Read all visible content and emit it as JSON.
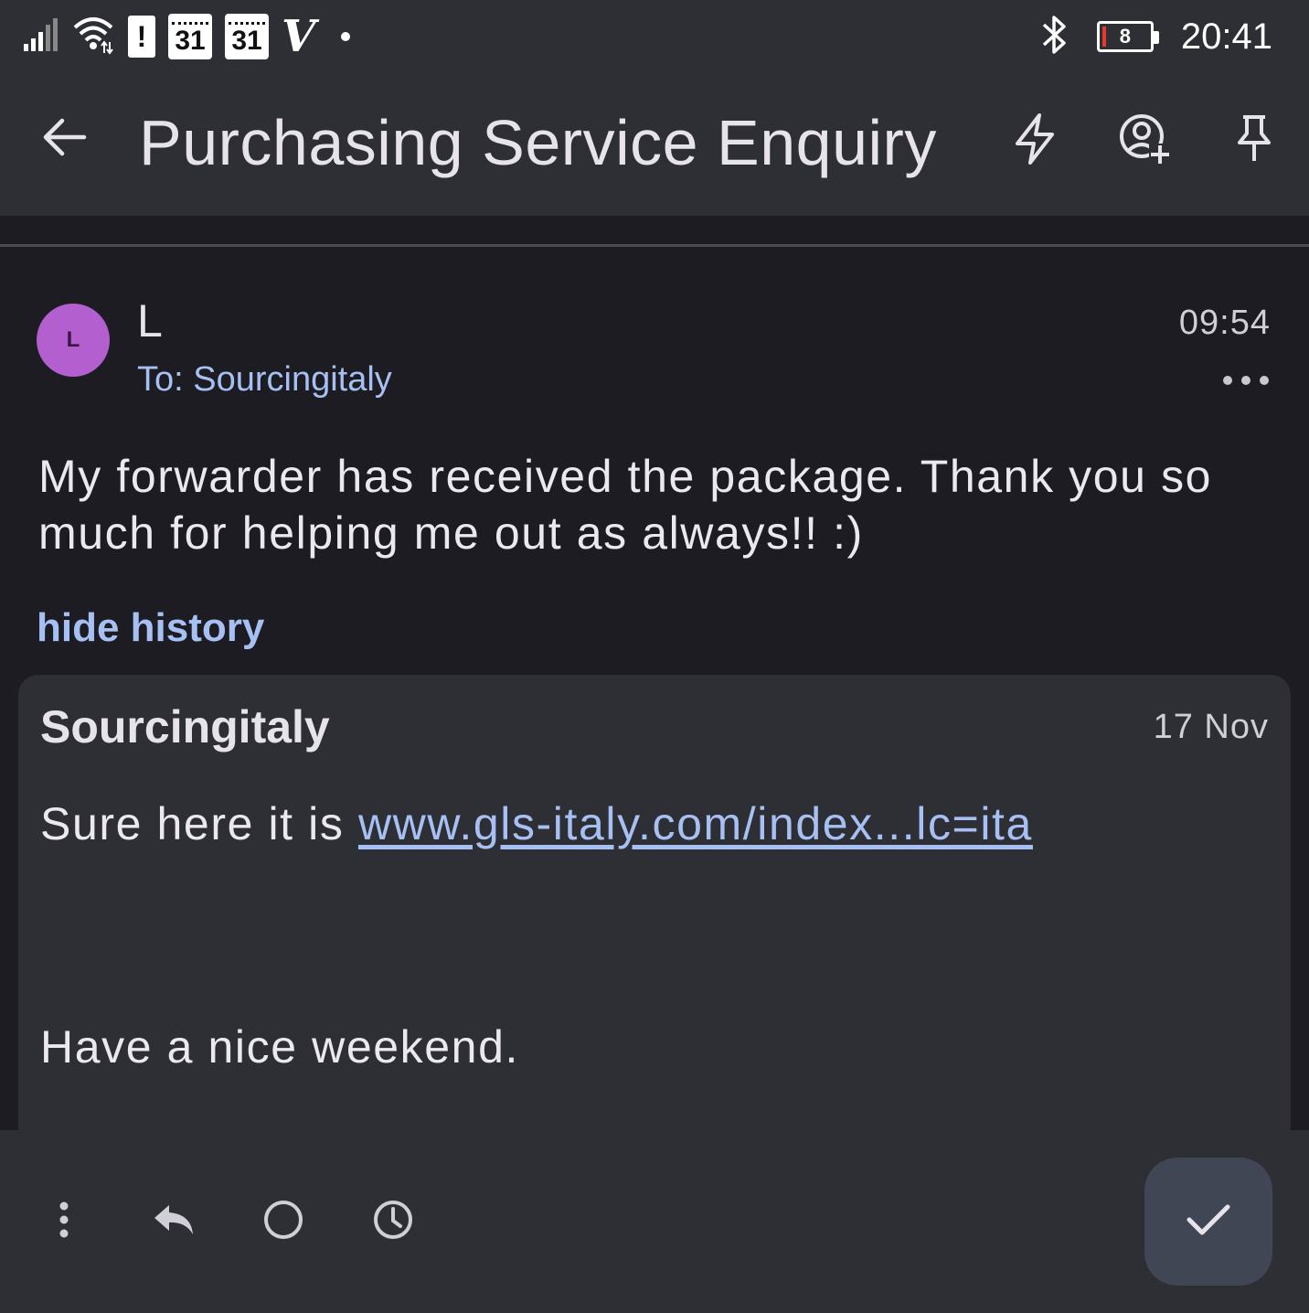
{
  "status_bar": {
    "calendar_day_1": "31",
    "calendar_day_2": "31",
    "notification_mark": "!",
    "app_logo": "V",
    "battery_level": "8",
    "clock": "20:41",
    "icons": [
      "signal-icon",
      "wifi-icon",
      "alert-icon",
      "calendar-icon",
      "calendar-icon",
      "v-app-icon",
      "bluetooth-icon",
      "battery-icon"
    ]
  },
  "app_bar": {
    "title": "Purchasing Service Enquiry",
    "icons": [
      "back-arrow-icon",
      "lightning-icon",
      "add-contact-icon",
      "pin-icon"
    ]
  },
  "message": {
    "avatar_letter": "L",
    "sender": "L",
    "to": "To: Sourcingitaly",
    "time": "09:54",
    "body": "My forwarder has received the package. Thank you so much for helping me out as always!! :)",
    "hide_history_label": "hide history"
  },
  "history": {
    "sender": "Sourcingitaly",
    "date": "17 Nov",
    "line1_prefix": "Sure here it is ",
    "link_text": "www.gls-italy.com/index...lc=ita",
    "line2": "Have a nice weekend."
  },
  "bottom_bar": {
    "icons": [
      "more-vert-icon",
      "reply-icon",
      "circle-icon",
      "clock-icon",
      "check-icon"
    ]
  },
  "colors": {
    "background": "#1c1c22",
    "surface": "#2e2e35",
    "accent_link": "#a7c0f3",
    "avatar": "#b35fcf",
    "fab": "#414654"
  }
}
